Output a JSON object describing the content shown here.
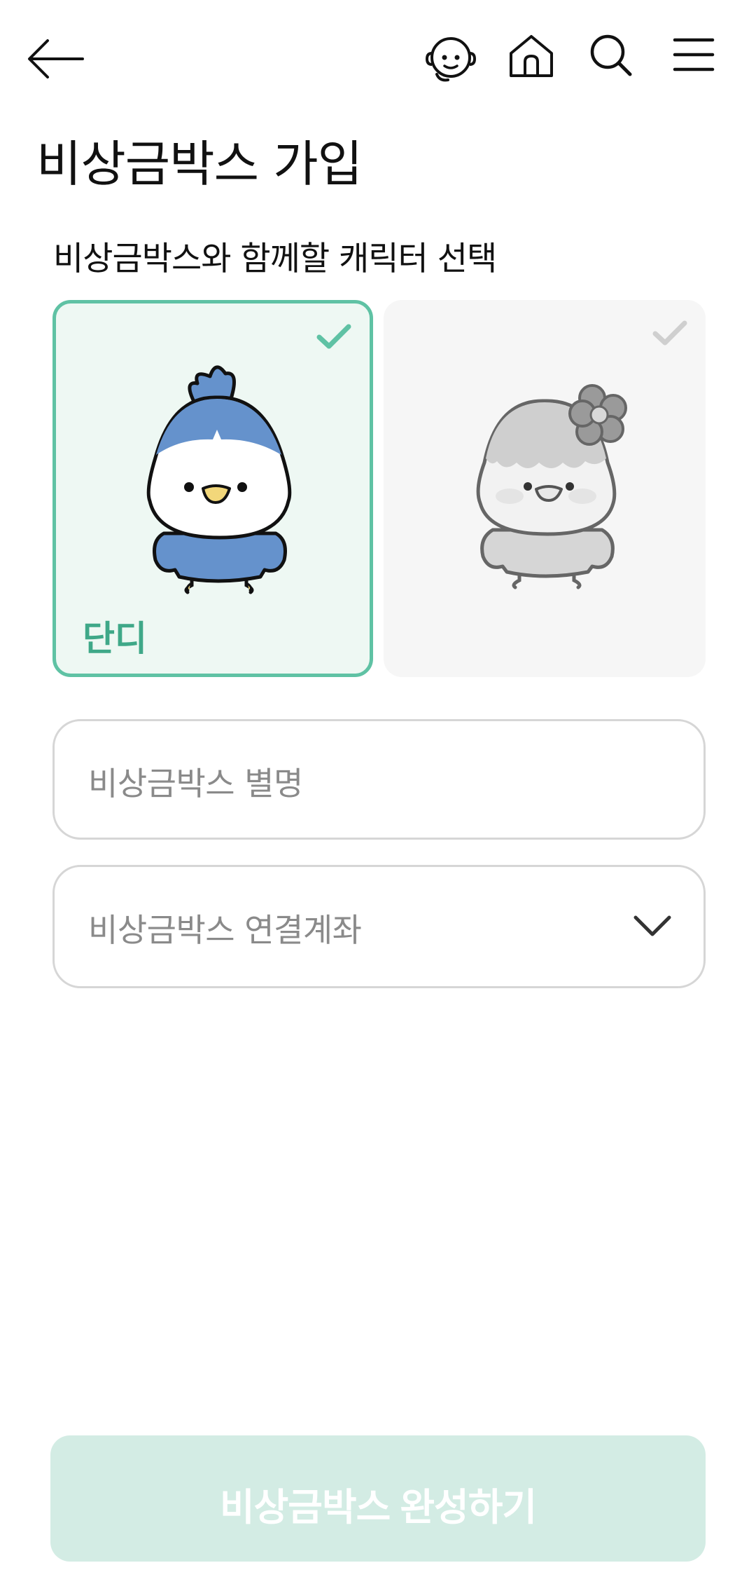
{
  "header": {
    "back_icon": "arrow-left-icon",
    "chatbot_icon": "chatbot-icon",
    "home_icon": "home-icon",
    "search_icon": "search-icon",
    "menu_icon": "hamburger-menu-icon"
  },
  "page": {
    "title": "비상금박스 가입",
    "section_label": "비상금박스와 함께할 캐릭터 선택"
  },
  "characters": [
    {
      "name": "단디",
      "selected": true,
      "check_color": "#5fc2a4"
    },
    {
      "name": "",
      "selected": false,
      "check_color": "#cfcfcf"
    }
  ],
  "form": {
    "nickname_placeholder": "비상금박스 별명",
    "account_placeholder": "비상금박스 연결계좌"
  },
  "submit": {
    "label": "비상금박스 완성하기"
  },
  "colors": {
    "accent": "#5fc2a4",
    "selected_card_bg": "#eef8f3",
    "disabled_button": "#d3ece4"
  }
}
